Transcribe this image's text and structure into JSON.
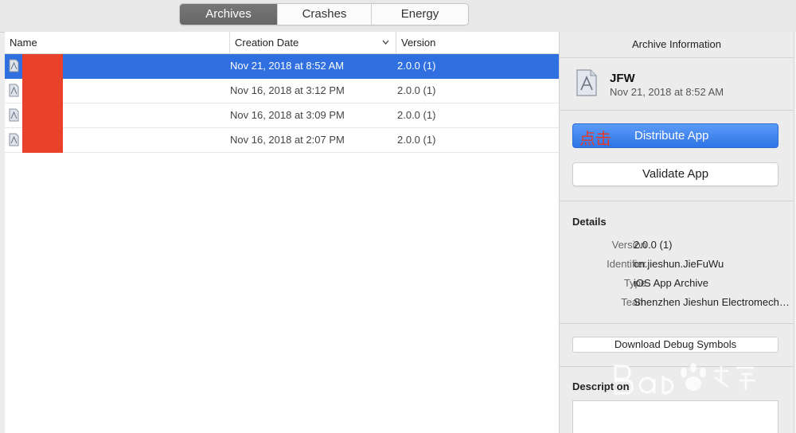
{
  "tabs": [
    {
      "label": "Archives",
      "active": true
    },
    {
      "label": "Crashes",
      "active": false
    },
    {
      "label": "Energy",
      "active": false
    }
  ],
  "list": {
    "columns": {
      "name": "Name",
      "date": "Creation Date",
      "version": "Version"
    },
    "sort_icon": "chevron-down-icon",
    "rows": [
      {
        "date": "Nov 21, 2018 at 8:52 AM",
        "version": "2.0.0 (1)",
        "selected": true
      },
      {
        "date": "Nov 16, 2018 at 3:12 PM",
        "version": "2.0.0 (1)",
        "selected": false
      },
      {
        "date": "Nov 16, 2018 at 3:09 PM",
        "version": "2.0.0 (1)",
        "selected": false
      },
      {
        "date": "Nov 16, 2018 at 2:07 PM",
        "version": "2.0.0 (1)",
        "selected": false
      }
    ]
  },
  "panel": {
    "title": "Archive Information",
    "archive_name": "JFW",
    "archive_date": "Nov 21, 2018 at 8:52 AM",
    "distribute_annotation": "点击",
    "distribute_label": "Distribute App",
    "validate_label": "Validate App",
    "details_title": "Details",
    "details": [
      {
        "key": "Version",
        "value": "2.0.0 (1)"
      },
      {
        "key": "Identifier",
        "value": "cn.jieshun.JieFuWu"
      },
      {
        "key": "Type",
        "value": "iOS App Archive"
      },
      {
        "key": "Team",
        "value": "Shenzhen Jieshun Electromechanical"
      }
    ],
    "debug_symbols_label": "Download Debug Symbols",
    "description_title": "Description"
  },
  "colors": {
    "selection": "#2f6fe0",
    "redaction": "#e8432a",
    "annotation": "#e23a2a",
    "accent": "#2f74e6"
  }
}
